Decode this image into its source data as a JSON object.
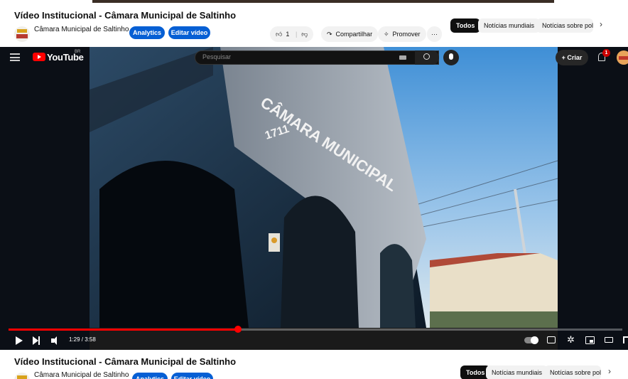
{
  "video": {
    "title": "Vídeo Institucional - Câmara Municipal de Saltinho",
    "channel": "Câmara Municipal de Saltinho",
    "subscribers": "",
    "analytics_label": "Analytics",
    "edit_label": "Editar vídeo",
    "like_count": "1",
    "share_label": "Compartilhar",
    "promote_label": "Promover",
    "more_label": "···"
  },
  "chips": {
    "items": [
      "Todos",
      "Notícias mundiais",
      "Notícias sobre polí"
    ],
    "next": "›"
  },
  "masthead": {
    "brand": "YouTube",
    "country_code": "BR",
    "search_placeholder": "Pesquisar",
    "create_label": "+ Criar",
    "notification_count": "1"
  },
  "scene": {
    "building_sign": "CÂMARA MUNICIPAL",
    "building_number": "1711"
  },
  "player": {
    "time_display": "1:29 / 3:58",
    "progress": 0.3739,
    "settings_glyph": "✲"
  },
  "colors": {
    "accent_red": "#ff0000",
    "button_blue": "#065fd4",
    "chip_active": "#0f0f0f"
  },
  "icons": [
    "menu-icon",
    "youtube-logo-icon",
    "keyboard-icon",
    "search-icon",
    "mic-icon",
    "bell-icon",
    "avatar",
    "play-icon",
    "next-icon",
    "volume-icon",
    "autoplay-toggle",
    "subtitles-icon",
    "settings-icon",
    "miniplayer-icon",
    "theater-icon",
    "fullscreen-icon",
    "like-icon",
    "dislike-icon",
    "share-icon",
    "promote-icon",
    "chevron-right-icon"
  ]
}
